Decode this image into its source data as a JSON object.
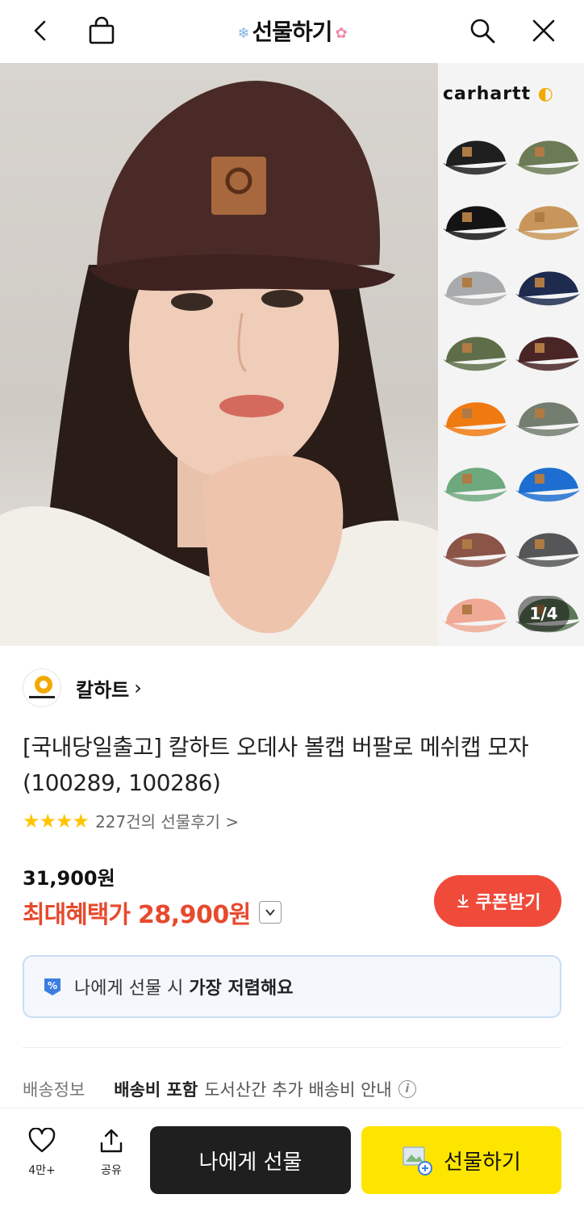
{
  "header": {
    "title": "선물하기",
    "back_icon": "chevron-left-icon",
    "bag_icon": "shopping-bag-icon",
    "search_icon": "search-icon",
    "close_icon": "close-icon"
  },
  "hero": {
    "brand_logo_text": "carhartt",
    "pager": "1/4",
    "swatch_colors": [
      "#1f1f1f",
      "#6b7b55",
      "#141414",
      "#c8965a",
      "#a9aaab",
      "#1e2b4f",
      "#5d6e48",
      "#4a2526",
      "#f07a12",
      "#747e70",
      "#6ea97e",
      "#1d6ed0",
      "#8a5447",
      "#545657",
      "#f0a995",
      "#5d7858"
    ]
  },
  "brand": {
    "name": "칼하트"
  },
  "product": {
    "title": "[국내당일출고] 칼하트 오데사 볼캡 버팔로 메쉬캡 모자 (100289, 100286)",
    "stars": "★★★★",
    "review_link": "227건의 선물후기 >",
    "price": "31,900원",
    "max_benefit_label": "최대혜택가",
    "max_benefit_value": "28,900원",
    "coupon_button": "쿠폰받기"
  },
  "info_box": {
    "text_normal": "나에게 선물 시 ",
    "text_bold": "가장 저렴해요"
  },
  "shipping": {
    "label": "배송정보",
    "main": "배송비 포함",
    "sub": "도서산간 추가 배송비 안내",
    "info_icon": "i"
  },
  "bottom_bar": {
    "like_count": "4만+",
    "share_label": "공유",
    "self_gift_button": "나에게 선물",
    "gift_button": "선물하기"
  },
  "colors": {
    "accent_red": "#e64a2e",
    "coupon_red": "#f04a3b",
    "kakao_yellow": "#fee500",
    "star_yellow": "#ffc400"
  }
}
